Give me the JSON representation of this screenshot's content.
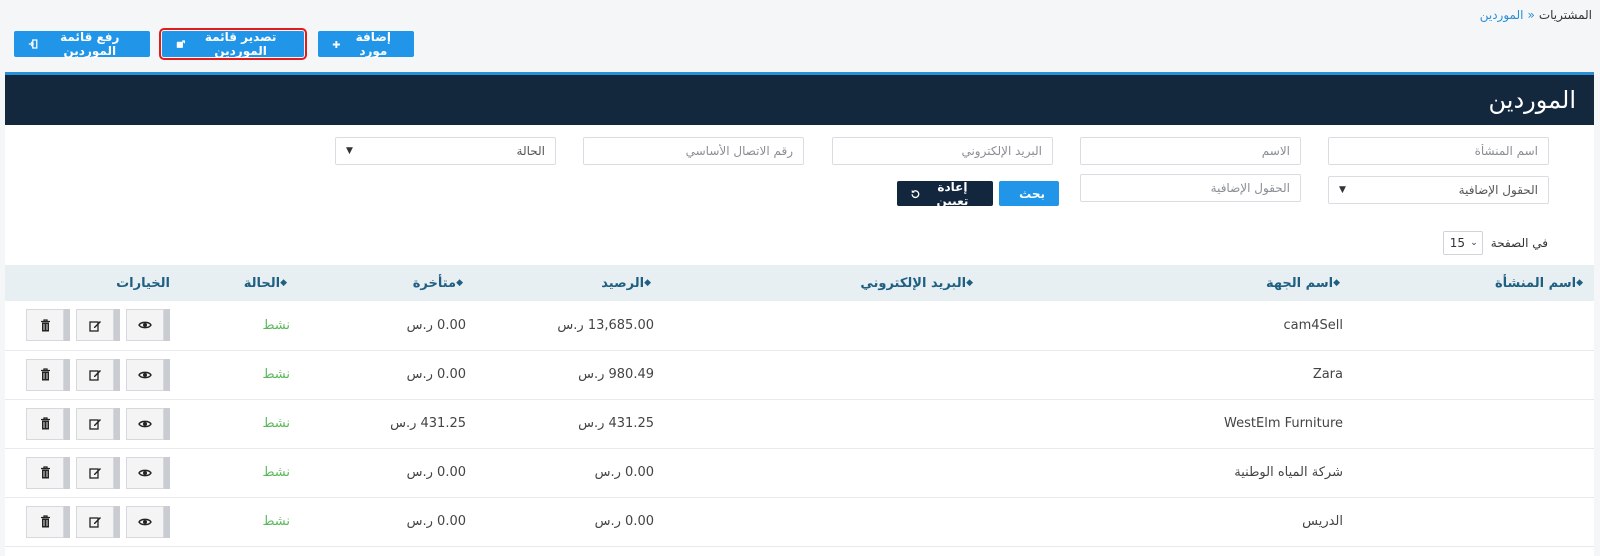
{
  "breadcrumb": {
    "root": "المشتريات",
    "separator": "»",
    "current": "الموردين"
  },
  "actions": {
    "upload_label": "رفع قائمة الموردين",
    "export_label": "تصدير قائمة الموردين",
    "add_label": "إضافة مورد"
  },
  "panel": {
    "title": "الموردين"
  },
  "filters": {
    "company_name_placeholder": "اسم المنشأة",
    "name_placeholder": "الاسم",
    "email_placeholder": "البريد الإلكتروني",
    "phone_placeholder": "رقم الاتصال الأساسي",
    "status_label": "الحالة",
    "extra_fields_select": "الحقول الإضافية",
    "extra_fields_placeholder": "الحقول الإضافية",
    "search_label": "بحث",
    "reset_label": "إعادة تعيين"
  },
  "per_page": {
    "label": "في الصفحة",
    "value": "15"
  },
  "table": {
    "columns": [
      "اسم المنشأة",
      "اسم الجهة",
      "البريد الإلكتروني",
      "الرصيد",
      "متأخرة",
      "الحالة",
      "الخيارات"
    ],
    "rows": [
      {
        "company": "",
        "contact": "cam4Sell",
        "email": "",
        "balance": "13,685.00 ر.س",
        "overdue": "0.00 ر.س",
        "status": "نشط"
      },
      {
        "company": "",
        "contact": "Zara",
        "email": "",
        "balance": "980.49 ر.س",
        "overdue": "0.00 ر.س",
        "status": "نشط"
      },
      {
        "company": "",
        "contact": "WestElm Furniture",
        "email": "",
        "balance": "431.25 ر.س",
        "overdue": "431.25 ر.س",
        "status": "نشط"
      },
      {
        "company": "",
        "contact": "شركة المياه الوطنية",
        "email": "",
        "balance": "0.00 ر.س",
        "overdue": "0.00 ر.س",
        "status": "نشط"
      },
      {
        "company": "",
        "contact": "الدريس",
        "email": "",
        "balance": "0.00 ر.س",
        "overdue": "0.00 ر.س",
        "status": "نشط"
      }
    ]
  },
  "icons": {
    "upload": "sign-in-icon",
    "export": "share-icon",
    "add": "plus-icon",
    "search": "filter-icon",
    "reset": "undo-icon",
    "view": "eye-icon",
    "edit": "edit-icon",
    "delete": "trash-icon"
  },
  "colors": {
    "primary": "#2196e8",
    "header_dark": "#13273d",
    "status_active": "#5cb85c",
    "highlight": "#e31b1b"
  }
}
